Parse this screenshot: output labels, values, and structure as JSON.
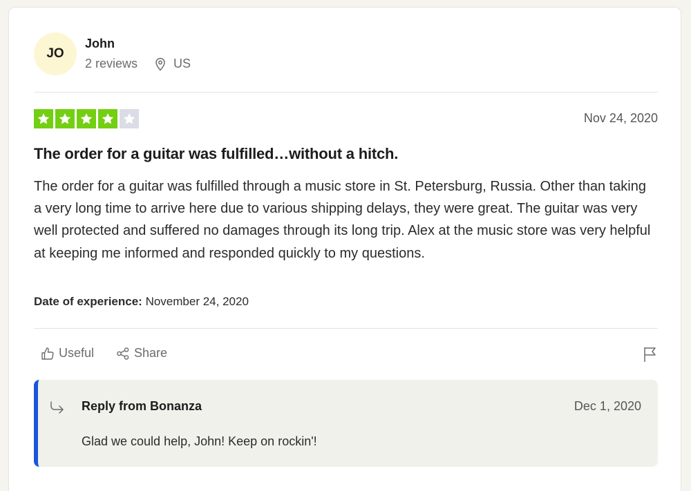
{
  "reviewer": {
    "initials": "JO",
    "name": "John",
    "reviews": "2 reviews",
    "country": "US"
  },
  "review": {
    "rating": 4,
    "max_rating": 5,
    "date": "Nov 24, 2020",
    "title": "The order for a guitar was fulfilled…without a hitch.",
    "body": "The order for a guitar was fulfilled through a music store in St. Petersburg, Russia. Other than taking a very long time to arrive here due to various shipping delays, they were great. The guitar was very well protected and suffered no damages through its long trip. Alex at the music store was very helpful at keeping me informed and responded quickly to my questions.",
    "experience_label": "Date of experience:",
    "experience_date": "November 24, 2020"
  },
  "actions": {
    "useful_label": "Useful",
    "share_label": "Share",
    "useful_icon": "thumbs-up-icon",
    "share_icon": "share-icon",
    "flag_icon": "flag-icon"
  },
  "reply": {
    "title": "Reply from Bonanza",
    "date": "Dec 1, 2020",
    "text": "Glad we could help, John! Keep on rockin'!",
    "icon": "reply-arrow-icon"
  },
  "colors": {
    "star_on": "#73cf11",
    "star_off": "#dcdce6",
    "reply_accent": "#1a56db",
    "avatar_bg": "#fdf6d3"
  }
}
